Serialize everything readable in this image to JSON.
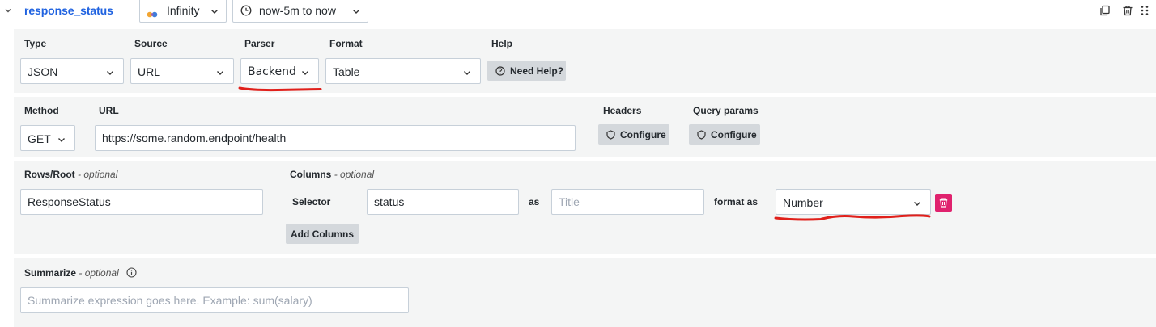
{
  "header": {
    "query_name": "response_status",
    "datasource": "Infinity",
    "time_range": "now-5m to now"
  },
  "source_panel": {
    "type_label": "Type",
    "type_value": "JSON",
    "source_label": "Source",
    "source_value": "URL",
    "parser_label": "Parser",
    "parser_value": "Backend",
    "format_label": "Format",
    "format_value": "Table",
    "help_label": "Help",
    "help_button": "Need Help?"
  },
  "request_panel": {
    "method_label": "Method",
    "method_value": "GET",
    "url_label": "URL",
    "url_value": "https://some.random.endpoint/health",
    "headers_label": "Headers",
    "headers_button": "Configure",
    "query_params_label": "Query params",
    "query_params_button": "Configure"
  },
  "parsing_panel": {
    "rows_root_label": "Rows/Root",
    "optional_text": "- optional",
    "rows_root_value": "ResponseStatus",
    "columns_label": "Columns",
    "selector_label": "Selector",
    "selector_value": "status",
    "as_label": "as",
    "title_placeholder": "Title",
    "format_as_label": "format as",
    "format_as_value": "Number",
    "add_columns_button": "Add Columns"
  },
  "summarize_panel": {
    "label": "Summarize",
    "optional_text": "- optional",
    "placeholder": "Summarize expression goes here. Example: sum(salary)"
  },
  "colors": {
    "accent_blue": "#1f62e0",
    "panel_bg": "#f4f5f5",
    "annotation_red": "#e0201b",
    "delete_pink": "#e0226e"
  }
}
